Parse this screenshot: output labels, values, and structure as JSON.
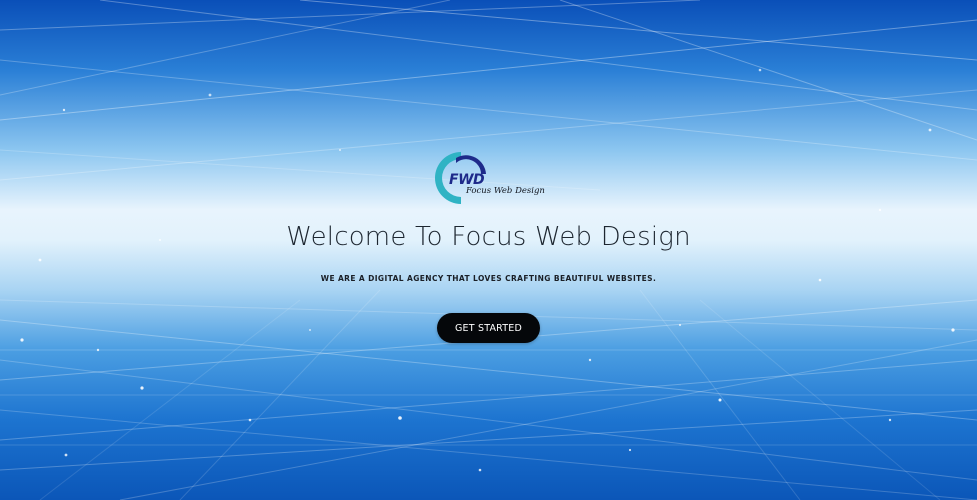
{
  "hero": {
    "logo": {
      "brand_initials": "FWD",
      "brand_name": "Focus Web Design"
    },
    "headline": "Welcome To Focus Web Design",
    "tagline": "WE ARE A DIGITAL AGENCY THAT LOVES CRAFTING BEAUTIFUL WEBSITES.",
    "cta_label": "GET STARTED"
  },
  "colors": {
    "background_top": "#0a4fb8",
    "background_center": "#e8f4fd",
    "background_bottom": "#0b56b8",
    "logo_teal": "#2fb3c4",
    "logo_navy": "#1e2a8a",
    "headline_text": "#1d2630",
    "button_bg": "#05070a",
    "button_text": "#ffffff"
  }
}
